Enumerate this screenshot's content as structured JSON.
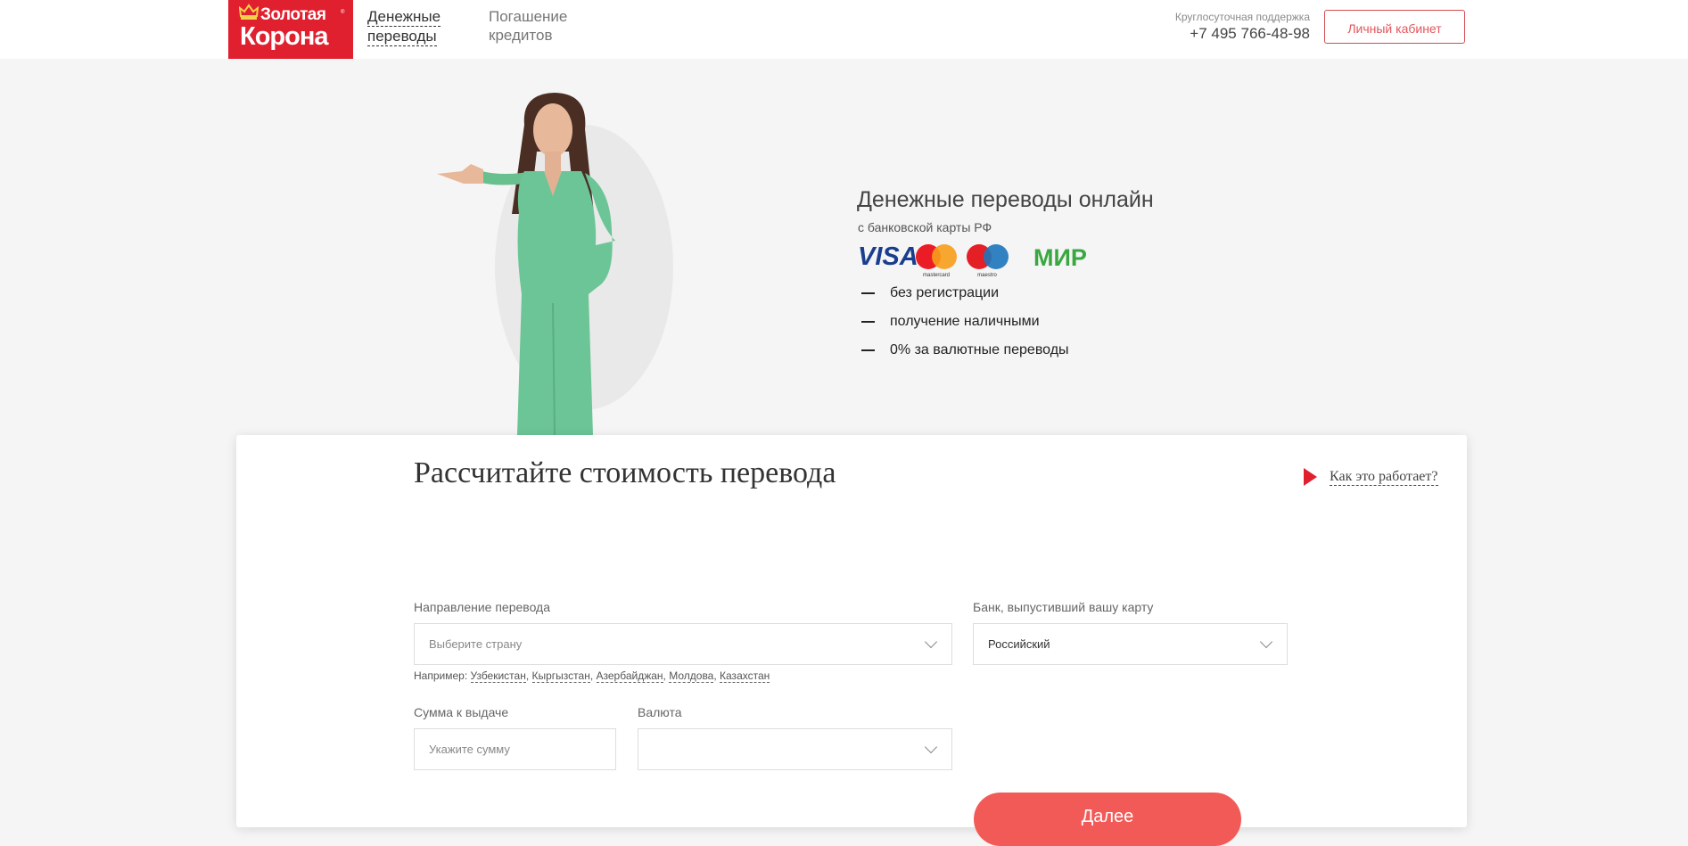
{
  "header": {
    "logo": {
      "line1": "Золотая",
      "line2": "Корона",
      "reg": "®"
    },
    "nav": [
      {
        "line1": "Денежные",
        "line2": "переводы"
      },
      {
        "line1": "Погашение",
        "line2": "кредитов"
      }
    ],
    "support_label": "Круглосуточная поддержка",
    "support_phone": "+7 495 766-48-98",
    "cabinet_button": "Личный кабинет"
  },
  "hero": {
    "title": "Денежные переводы онлайн",
    "subtitle": "с банковской карты РФ",
    "cards": [
      {
        "name": "VISA",
        "caption": ""
      },
      {
        "name": "mastercard",
        "caption": "mastercard"
      },
      {
        "name": "maestro",
        "caption": "maestro"
      },
      {
        "name": "МИР",
        "caption": ""
      }
    ],
    "features": [
      "без регистрации",
      "получение наличными",
      "0% за валютные переводы"
    ]
  },
  "calculator": {
    "title": "Рассчитайте стоимость перевода",
    "how_link": "Как это работает?",
    "direction": {
      "label": "Направление перевода",
      "placeholder": "Выберите страну"
    },
    "bank": {
      "label": "Банк, выпустивший вашу карту",
      "value": "Российский"
    },
    "examples_label": "Например:",
    "examples": [
      "Узбекистан",
      "Кыргызстан",
      "Азербайджан",
      "Молдова",
      "Казахстан"
    ],
    "amount": {
      "label": "Сумма к выдаче",
      "placeholder": "Укажите сумму"
    },
    "currency": {
      "label": "Валюта",
      "value": ""
    },
    "submit": "Далее"
  },
  "colors": {
    "brand_red": "#e0202f",
    "button_red": "#f25a58",
    "dress_green": "#6cc596"
  }
}
